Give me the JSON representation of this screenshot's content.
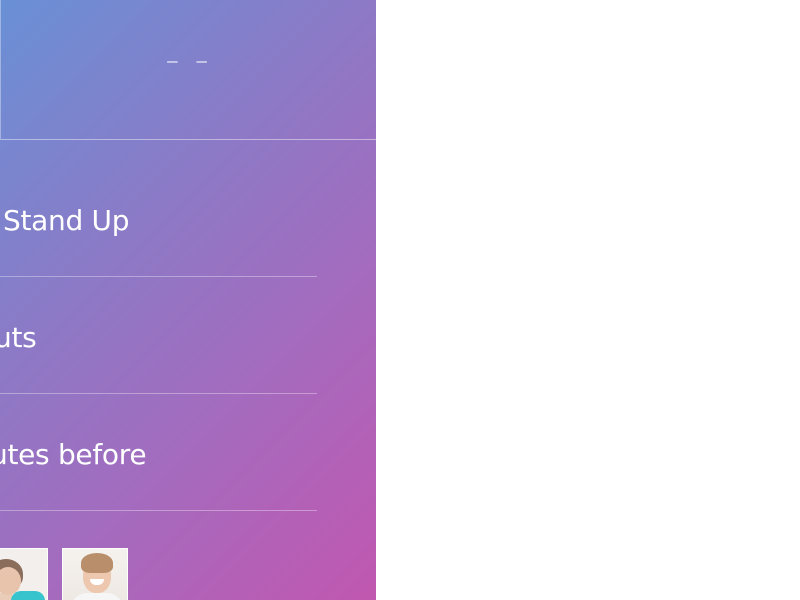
{
  "header": {
    "time": "– –"
  },
  "items": [
    {
      "label": "Stand Up"
    },
    {
      "label": "uts"
    },
    {
      "label": "utes before"
    }
  ],
  "colors": {
    "gradient_start": "#6990d6",
    "gradient_end": "#c157b0",
    "text": "#ffffff",
    "background": "#ffffff"
  },
  "avatars": [
    {
      "icon": "avatar-woman-icon"
    },
    {
      "icon": "avatar-man-icon"
    }
  ]
}
